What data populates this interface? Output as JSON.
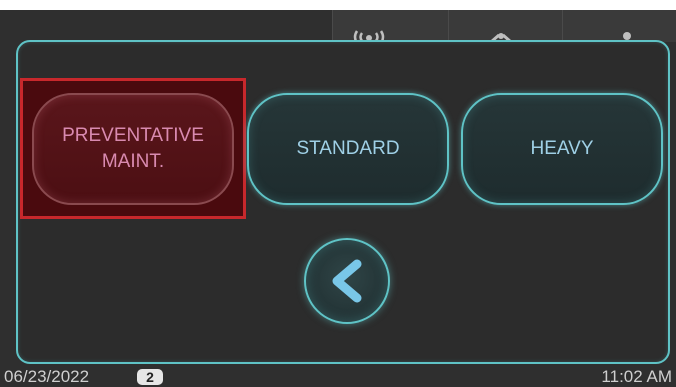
{
  "top_bar": {
    "icons": [
      "wireless-signal-icon",
      "wrench-icon",
      "person-icon"
    ]
  },
  "options": {
    "preventative": "PREVENTATIVE\nMAINT.",
    "standard": "STANDARD",
    "heavy": "HEAVY",
    "selected": "preventative"
  },
  "back_icon": "chevron-left-icon",
  "status": {
    "date": "06/23/2022",
    "badge": "2",
    "time": "11:02 AM"
  },
  "colors": {
    "accent": "#5fc3c6",
    "selected_border": "#c8282c",
    "selected_fill": "#4a0a0e",
    "background": "#2f2f2f"
  }
}
